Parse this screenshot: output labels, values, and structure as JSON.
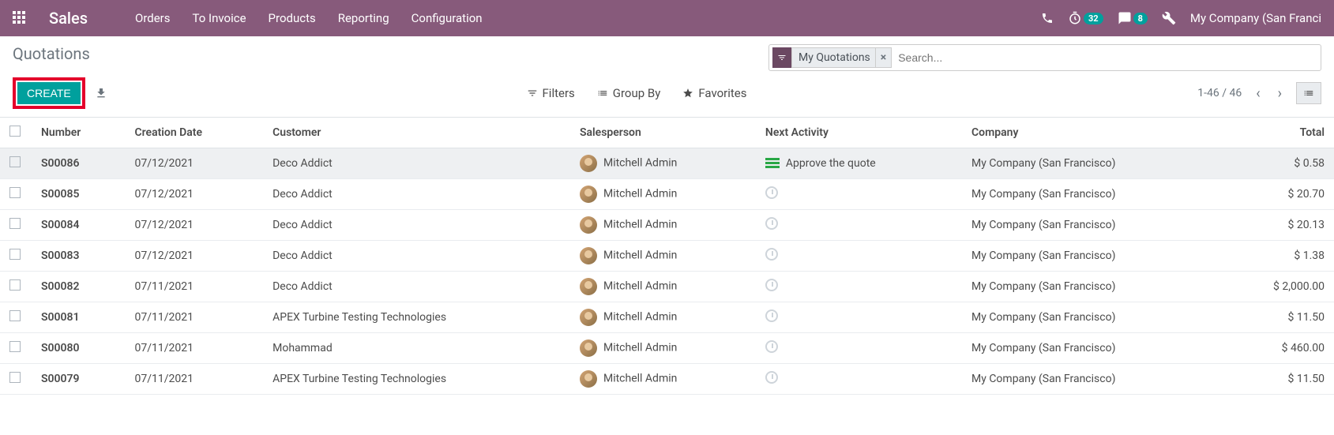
{
  "navbar": {
    "brand": "Sales",
    "links": [
      "Orders",
      "To Invoice",
      "Products",
      "Reporting",
      "Configuration"
    ],
    "timer_badge": "32",
    "msg_badge": "8",
    "company": "My Company (San Franci"
  },
  "breadcrumb": "Quotations",
  "search": {
    "chip_label": "My Quotations",
    "placeholder": "Search..."
  },
  "buttons": {
    "create": "CREATE",
    "filters": "Filters",
    "groupby": "Group By",
    "favorites": "Favorites"
  },
  "pager": "1-46 / 46",
  "columns": [
    "Number",
    "Creation Date",
    "Customer",
    "Salesperson",
    "Next Activity",
    "Company",
    "Total"
  ],
  "rows": [
    {
      "number": "S00086",
      "date": "07/12/2021",
      "customer": "Deco Addict",
      "salesperson": "Mitchell Admin",
      "activity": "Approve the quote",
      "activity_type": "task",
      "company": "My Company (San Francisco)",
      "total": "$ 0.58"
    },
    {
      "number": "S00085",
      "date": "07/12/2021",
      "customer": "Deco Addict",
      "salesperson": "Mitchell Admin",
      "activity": "",
      "activity_type": "clock",
      "company": "My Company (San Francisco)",
      "total": "$ 20.70"
    },
    {
      "number": "S00084",
      "date": "07/12/2021",
      "customer": "Deco Addict",
      "salesperson": "Mitchell Admin",
      "activity": "",
      "activity_type": "clock",
      "company": "My Company (San Francisco)",
      "total": "$ 20.13"
    },
    {
      "number": "S00083",
      "date": "07/12/2021",
      "customer": "Deco Addict",
      "salesperson": "Mitchell Admin",
      "activity": "",
      "activity_type": "clock",
      "company": "My Company (San Francisco)",
      "total": "$ 1.38"
    },
    {
      "number": "S00082",
      "date": "07/11/2021",
      "customer": "Deco Addict",
      "salesperson": "Mitchell Admin",
      "activity": "",
      "activity_type": "clock",
      "company": "My Company (San Francisco)",
      "total": "$ 2,000.00"
    },
    {
      "number": "S00081",
      "date": "07/11/2021",
      "customer": "APEX Turbine Testing Technologies",
      "salesperson": "Mitchell Admin",
      "activity": "",
      "activity_type": "clock",
      "company": "My Company (San Francisco)",
      "total": "$ 11.50"
    },
    {
      "number": "S00080",
      "date": "07/11/2021",
      "customer": "Mohammad",
      "salesperson": "Mitchell Admin",
      "activity": "",
      "activity_type": "clock",
      "company": "My Company (San Francisco)",
      "total": "$ 460.00"
    },
    {
      "number": "S00079",
      "date": "07/11/2021",
      "customer": "APEX Turbine Testing Technologies",
      "salesperson": "Mitchell Admin",
      "activity": "",
      "activity_type": "clock",
      "company": "My Company (San Francisco)",
      "total": "$ 11.50"
    }
  ]
}
